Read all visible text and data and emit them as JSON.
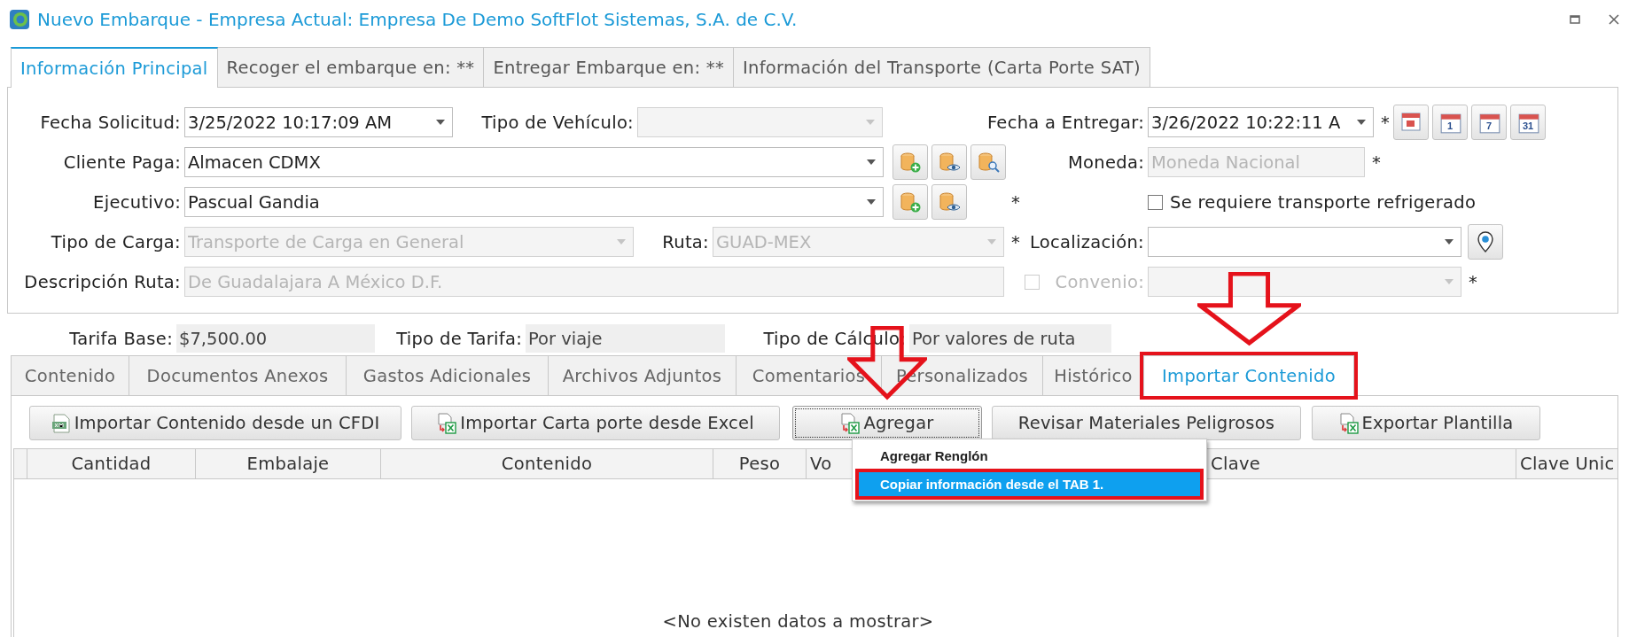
{
  "window": {
    "title": "Nuevo Embarque - Empresa Actual: Empresa De Demo SoftFlot Sistemas, S.A. de C.V."
  },
  "main_tabs": [
    {
      "label": "Información Principal",
      "selected": true
    },
    {
      "label": "Recoger el embarque en: **",
      "selected": false
    },
    {
      "label": "Entregar Embarque en: **",
      "selected": false
    },
    {
      "label": "Información del Transporte (Carta Porte SAT)",
      "selected": false
    }
  ],
  "form": {
    "fecha_solicitud": {
      "label": "Fecha Solicitud:",
      "value": "3/25/2022 10:17:09 AM",
      "disabled": false
    },
    "tipo_vehiculo": {
      "label": "Tipo de Vehículo:",
      "disabled": true
    },
    "fecha_entregar": {
      "label": "Fecha a Entregar:",
      "value": "3/26/2022 10:22:11 A",
      "disabled": false,
      "required_mark": "*"
    },
    "date_buttons": [
      {
        "kind": "today"
      },
      {
        "kind": "number",
        "label": "1"
      },
      {
        "kind": "number",
        "label": "7"
      },
      {
        "kind": "number",
        "label": "31"
      }
    ],
    "cliente_paga": {
      "label": "Cliente Paga:",
      "value": "Almacen CDMX",
      "disabled": false
    },
    "cliente_buttons": [
      {
        "kind": "add"
      },
      {
        "kind": "view"
      },
      {
        "kind": "search"
      }
    ],
    "moneda": {
      "label": "Moneda:",
      "value": "Moneda Nacional",
      "disabled": true,
      "required_mark": "*"
    },
    "ejecutivo": {
      "label": "Ejecutivo:",
      "value": "Pascual Gandia",
      "disabled": false,
      "required_mark": "*"
    },
    "ejecutivo_buttons": [
      {
        "kind": "add"
      },
      {
        "kind": "view"
      }
    ],
    "refrigerado": {
      "label": "Se requiere transporte refrigerado",
      "checked": false,
      "disabled": false
    },
    "tipo_carga": {
      "label": "Tipo de Carga:",
      "value": "Transporte de Carga en General",
      "disabled": true
    },
    "ruta": {
      "label": "Ruta:",
      "value": "GUAD-MEX",
      "disabled": true,
      "required_mark": "*"
    },
    "localizacion": {
      "label": "Localización:",
      "disabled": false
    },
    "descripcion_ruta": {
      "label": "Descripción Ruta:",
      "value": "De Guadalajara A México D.F.",
      "disabled": true
    },
    "convenio": {
      "label": "Convenio:",
      "checked": false,
      "disabled": true,
      "required_mark": "*"
    }
  },
  "tarifas": [
    {
      "label": "Tarifa Base:",
      "value": "$7,500.00"
    },
    {
      "label": "Tipo de Tarifa:",
      "value": "Por viaje"
    },
    {
      "label": "Tipo de Cálculo:",
      "value": "Por valores de ruta"
    }
  ],
  "sub_tabs": [
    {
      "label": "Contenido",
      "selected": false,
      "callout": false
    },
    {
      "label": "Documentos Anexos",
      "selected": false,
      "callout": false
    },
    {
      "label": "Gastos Adicionales",
      "selected": false,
      "callout": false
    },
    {
      "label": "Archivos Adjuntos",
      "selected": false,
      "callout": false
    },
    {
      "label": "Comentarios",
      "selected": false,
      "callout": false
    },
    {
      "label": "Personalizados",
      "selected": false,
      "callout": false
    },
    {
      "label": "Histórico",
      "selected": false,
      "callout": false
    },
    {
      "label": "Importar Contenido",
      "selected": true,
      "callout": true
    }
  ],
  "toolbar": [
    {
      "label": "Importar Contenido desde un CFDI",
      "kind": "xml",
      "focused": false,
      "callout": false
    },
    {
      "label": "Importar Carta porte desde Excel",
      "kind": "excel",
      "focused": false,
      "callout": false
    },
    {
      "label": "Agregar",
      "kind": "excel",
      "focused": true,
      "callout": true
    },
    {
      "label": "Revisar Materiales Peligrosos",
      "kind": "plain",
      "focused": false,
      "callout": false
    },
    {
      "label": "Exportar Plantilla",
      "kind": "excel",
      "focused": false,
      "callout": false
    }
  ],
  "grid": {
    "columns": [
      {
        "label": "Cantidad"
      },
      {
        "label": "Embalaje"
      },
      {
        "label": "Contenido"
      },
      {
        "label": "Peso"
      },
      {
        "label": "Vo"
      },
      {
        "label": "Clave"
      },
      {
        "label": "Clave Unic"
      }
    ],
    "empty_text": "<No existen datos a mostrar>"
  },
  "dropdown_menu": {
    "items": [
      {
        "label": "Agregar Renglón",
        "selected": false,
        "callout": false
      },
      {
        "label": "Copiar información desde el TAB 1.",
        "selected": true,
        "callout": true
      }
    ]
  }
}
